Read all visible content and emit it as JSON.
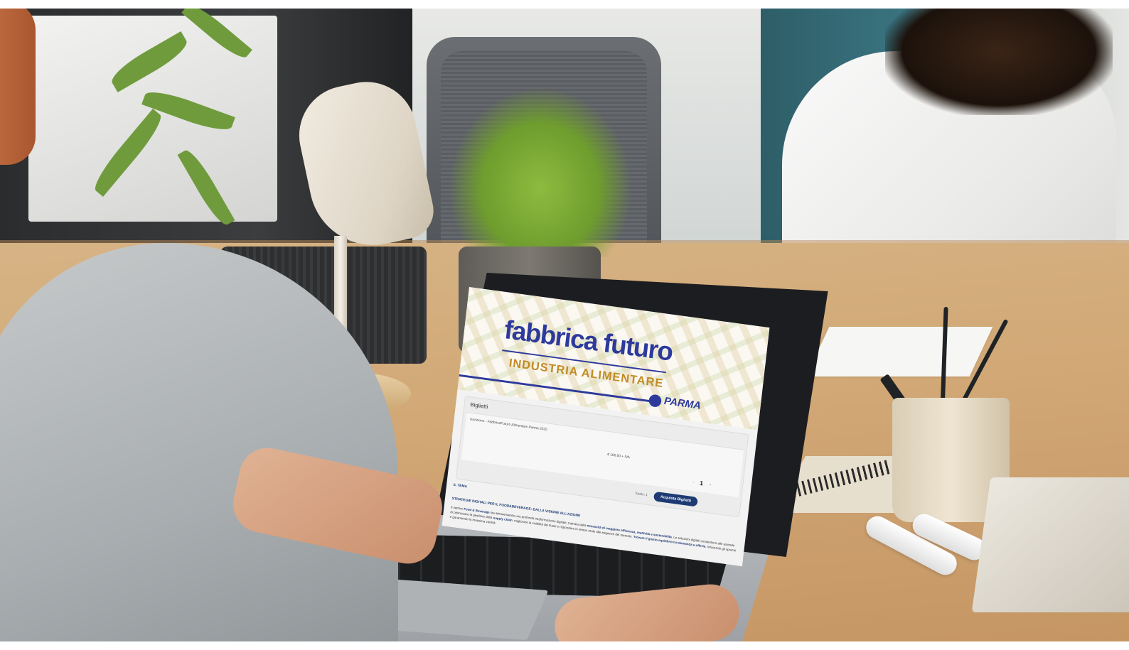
{
  "screen": {
    "banner": {
      "logo": "fabbrica futuro",
      "subtitle": "INDUSTRIA ALIMENTARE",
      "city": "PARMA"
    },
    "tickets": {
      "title": "Biglietti",
      "item_name": "Iscrizione - FabbricaFuturo Alimentare Parma 2025",
      "price": "€ 160,00 + IVA",
      "qty_minus": "-",
      "qty_value": "1",
      "qty_plus": "+",
      "total_label": "Totale: 1",
      "buy_button": "Acquista Biglietti"
    },
    "theme": {
      "label": "IL TEMA",
      "heading": "STRATEGIE DIGITALI PER IL FOOD&BEVERAGE: DALLA VISIONE ALL'AZIONE",
      "body_lead": "Il settore ",
      "body_b1": "Food & Beverage",
      "body_mid1": " sta attraversando una profonda trasformazione digitale, trainata dalla ",
      "body_b2": "necessità di maggiore efficienza, reattività e sostenibilità",
      "body_mid2": ". Le soluzioni digitali consentono alle aziende di ottimizzare la gestione della ",
      "body_b3": "supply chain",
      "body_mid3": ", migliorare la visibilità dei flussi e rispondere in tempo reale alle esigenze del mercato. ",
      "body_b4": "Trovare il giusto equilibrio tra domanda e offerta",
      "body_tail": ", riducendo gli sprechi e garantendo la massima varietà"
    }
  },
  "colors": {
    "brand_blue": "#2d3a9c",
    "brand_gold": "#c28b25",
    "button_navy": "#1d3a72"
  }
}
